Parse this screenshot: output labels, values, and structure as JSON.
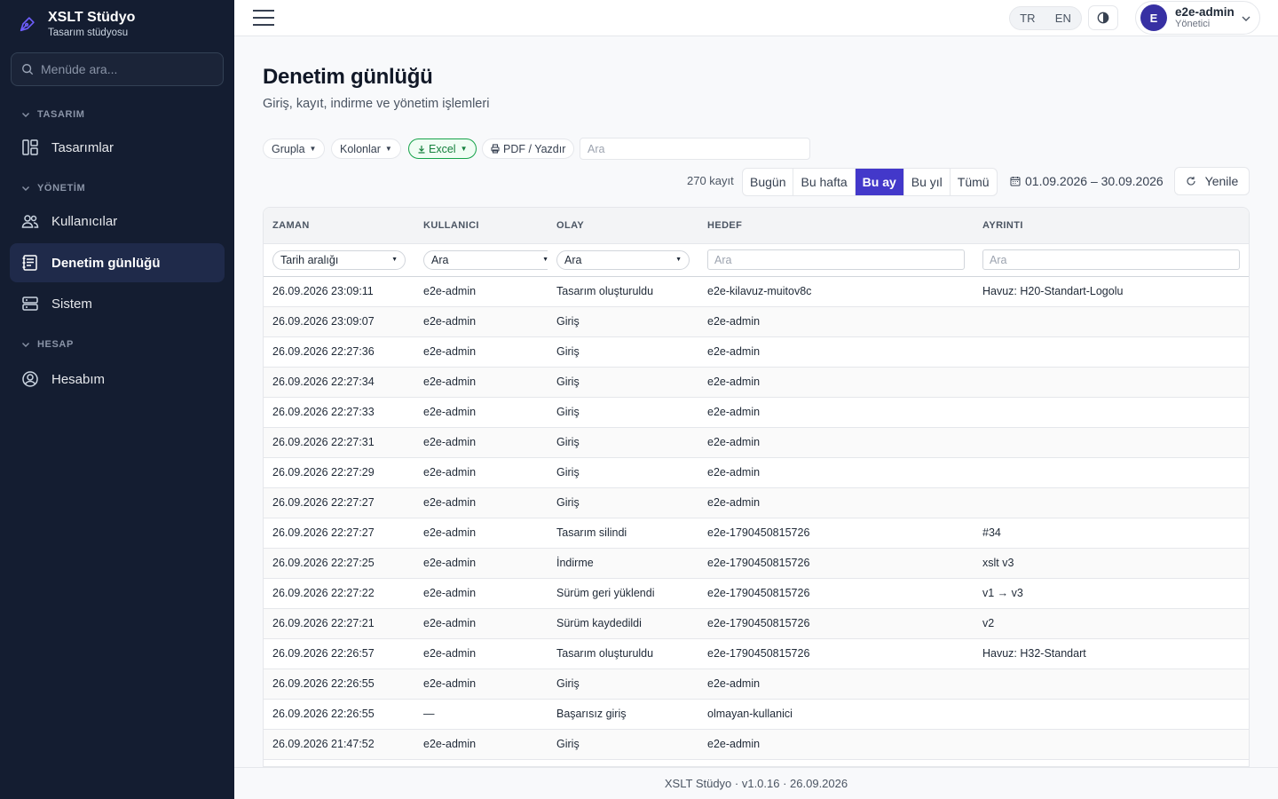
{
  "brand": {
    "name": "XSLT Stüdyo",
    "subtitle": "Tasarım stüdyosu"
  },
  "menu_search": {
    "placeholder": "Menüde ara..."
  },
  "sidebar": {
    "sections": [
      {
        "title": "TASARIM",
        "items": [
          {
            "label": "Tasarımlar",
            "icon": "layout-icon"
          }
        ]
      },
      {
        "title": "YÖNETİM",
        "items": [
          {
            "label": "Kullanıcılar",
            "icon": "users-icon"
          },
          {
            "label": "Denetim günlüğü",
            "icon": "log-icon",
            "active": true
          },
          {
            "label": "Sistem",
            "icon": "server-icon"
          }
        ]
      },
      {
        "title": "HESAP",
        "items": [
          {
            "label": "Hesabım",
            "icon": "user-circle-icon"
          }
        ]
      }
    ]
  },
  "topbar": {
    "lang": [
      "TR",
      "EN"
    ],
    "user": {
      "initial": "E",
      "name": "e2e-admin",
      "role": "Yönetici"
    }
  },
  "page": {
    "title": "Denetim günlüğü",
    "subtitle": "Giriş, kayıt, indirme ve yönetim işlemleri"
  },
  "toolbar": {
    "group": "Grupla",
    "columns": "Kolonlar",
    "excel": "Excel",
    "pdf": "PDF / Yazdır",
    "search_placeholder": "Ara"
  },
  "filters": {
    "count": "270 kayıt",
    "ranges": [
      "Bugün",
      "Bu hafta",
      "Bu ay",
      "Bu yıl",
      "Tümü"
    ],
    "active_range": "Bu ay",
    "date_range": "01.09.2026 – 30.09.2026",
    "refresh": "Yenile"
  },
  "table": {
    "headers": [
      "ZAMAN",
      "KULLANICI",
      "OLAY",
      "HEDEF",
      "AYRINTI"
    ],
    "filter_placeholders": {
      "time": "Tarih aralığı",
      "user": "Ara",
      "event": "Ara",
      "target": "Ara",
      "detail": "Ara"
    },
    "rows": [
      [
        "26.09.2026 23:09:11",
        "e2e-admin",
        "Tasarım oluşturuldu",
        "e2e-kilavuz-muitov8c",
        "Havuz: H20-Standart-Logolu"
      ],
      [
        "26.09.2026 23:09:07",
        "e2e-admin",
        "Giriş",
        "e2e-admin",
        ""
      ],
      [
        "26.09.2026 22:27:36",
        "e2e-admin",
        "Giriş",
        "e2e-admin",
        ""
      ],
      [
        "26.09.2026 22:27:34",
        "e2e-admin",
        "Giriş",
        "e2e-admin",
        ""
      ],
      [
        "26.09.2026 22:27:33",
        "e2e-admin",
        "Giriş",
        "e2e-admin",
        ""
      ],
      [
        "26.09.2026 22:27:31",
        "e2e-admin",
        "Giriş",
        "e2e-admin",
        ""
      ],
      [
        "26.09.2026 22:27:29",
        "e2e-admin",
        "Giriş",
        "e2e-admin",
        ""
      ],
      [
        "26.09.2026 22:27:27",
        "e2e-admin",
        "Giriş",
        "e2e-admin",
        ""
      ],
      [
        "26.09.2026 22:27:27",
        "e2e-admin",
        "Tasarım silindi",
        "e2e-1790450815726",
        "#34"
      ],
      [
        "26.09.2026 22:27:25",
        "e2e-admin",
        "İndirme",
        "e2e-1790450815726",
        "xslt v3"
      ],
      [
        "26.09.2026 22:27:22",
        "e2e-admin",
        "Sürüm geri yüklendi",
        "e2e-1790450815726",
        "v1 → v3"
      ],
      [
        "26.09.2026 22:27:21",
        "e2e-admin",
        "Sürüm kaydedildi",
        "e2e-1790450815726",
        "v2"
      ],
      [
        "26.09.2026 22:26:57",
        "e2e-admin",
        "Tasarım oluşturuldu",
        "e2e-1790450815726",
        "Havuz: H32-Standart"
      ],
      [
        "26.09.2026 22:26:55",
        "e2e-admin",
        "Giriş",
        "e2e-admin",
        ""
      ],
      [
        "26.09.2026 22:26:55",
        "—",
        "Başarısız giriş",
        "olmayan-kullanici",
        ""
      ],
      [
        "26.09.2026 21:47:52",
        "e2e-admin",
        "Giriş",
        "e2e-admin",
        ""
      ],
      [
        "",
        "",
        "",
        "",
        ""
      ]
    ]
  },
  "footer": {
    "text": "XSLT Stüdyo · v1.0.16 · 26.09.2026"
  },
  "colors": {
    "sidebar_bg": "#141d31",
    "accent": "#4338ca",
    "excel": "#16a34a"
  }
}
